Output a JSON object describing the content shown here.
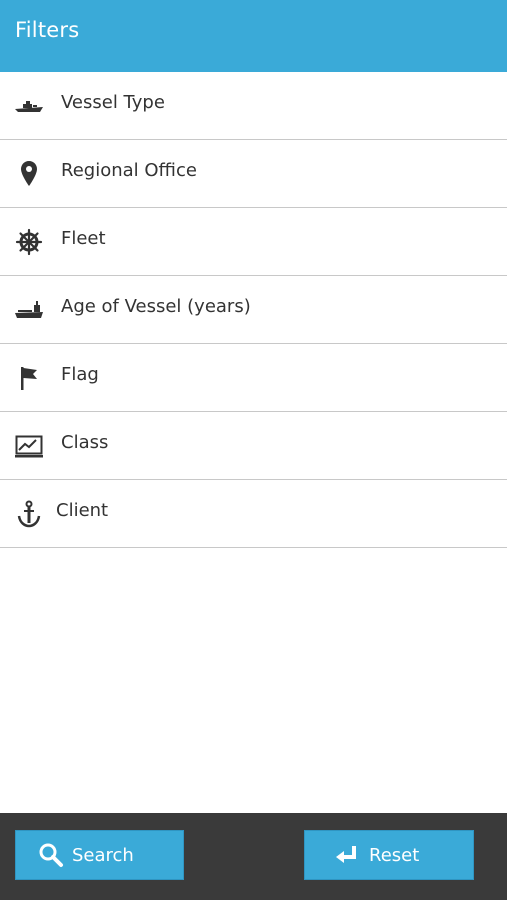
{
  "header": {
    "title": "Filters"
  },
  "filters": [
    {
      "label": "Vessel Type",
      "icon": "ship-icon"
    },
    {
      "label": "Regional Office",
      "icon": "map-pin-icon"
    },
    {
      "label": "Fleet",
      "icon": "ship-wheel-icon"
    },
    {
      "label": "Age of Vessel (years)",
      "icon": "tanker-icon"
    },
    {
      "label": "Flag",
      "icon": "flag-icon"
    },
    {
      "label": "Class",
      "icon": "chart-icon"
    },
    {
      "label": "Client",
      "icon": "anchor-icon"
    }
  ],
  "actions": {
    "search_label": "Search",
    "search_icon": "search-icon",
    "reset_label": "Reset",
    "reset_icon": "return-arrow-icon"
  },
  "colors": {
    "accent": "#3aaad8",
    "bottom_bar": "#3a3a3a",
    "divider": "#c8c8c8",
    "text": "#333333"
  }
}
